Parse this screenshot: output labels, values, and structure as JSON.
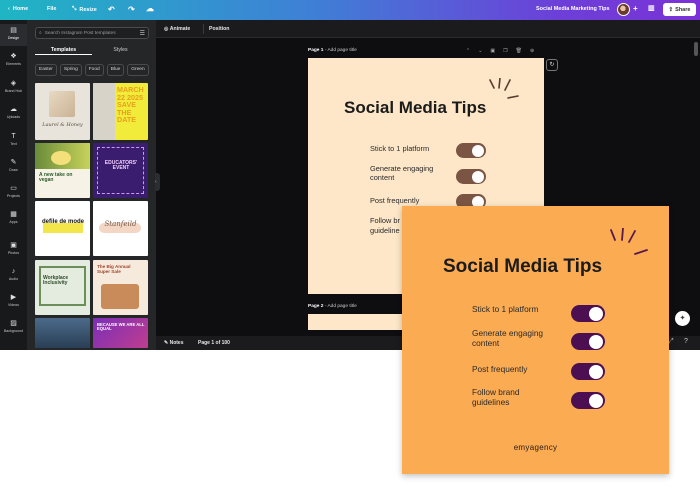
{
  "topbar": {
    "home": "Home",
    "file": "File",
    "resize": "Resize",
    "doc_title": "Social Media Marketing Tips",
    "share": "Share"
  },
  "rail": [
    {
      "label": "Design",
      "icon": "design-icon"
    },
    {
      "label": "Elements",
      "icon": "elements-icon"
    },
    {
      "label": "Brand Hub",
      "icon": "brand-hub-icon"
    },
    {
      "label": "Uploads",
      "icon": "upload-cloud-icon"
    },
    {
      "label": "Text",
      "icon": "text-icon"
    },
    {
      "label": "Draw",
      "icon": "draw-icon"
    },
    {
      "label": "Projects",
      "icon": "folder-icon"
    },
    {
      "label": "Apps",
      "icon": "apps-icon"
    },
    {
      "label": "Photos",
      "icon": "photos-icon"
    },
    {
      "label": "Audio",
      "icon": "audio-icon"
    },
    {
      "label": "Videos",
      "icon": "videos-icon"
    },
    {
      "label": "Background",
      "icon": "background-icon"
    }
  ],
  "panel": {
    "search_placeholder": "Search Instagram Post templates",
    "tabs": [
      "Templates",
      "Styles"
    ],
    "chips": [
      "Easter",
      "Spring",
      "Food",
      "Blue",
      "Green"
    ],
    "thumbnails": [
      {
        "text": "Laurel & Honey"
      },
      {
        "text": "MARCH 22 2025 SAVE THE DATE"
      },
      {
        "text": "A new take on vegan"
      },
      {
        "text": "EDUCATORS' EVENT"
      },
      {
        "text": "defile de mode"
      },
      {
        "text": "Stanfeild"
      },
      {
        "text": "Workplace Inclusivity"
      },
      {
        "text": "The Big Annual Super Sale"
      },
      {
        "text": ""
      },
      {
        "text": "BECAUSE WE ARE ALL EQUAL"
      }
    ]
  },
  "canvas": {
    "context_bar": {
      "animate": "Animate",
      "position": "Position"
    },
    "page1_label": "Page 1",
    "page1_hint": "- Add page title",
    "page2_label": "Page 2",
    "page2_hint": "- Add page title",
    "notes": "Notes",
    "page_counter": "Page 1 of 100"
  },
  "design_canvas": {
    "title": "Social Media Tips",
    "tips": [
      "Stick to 1 platform",
      "Generate engaging content",
      "Post frequently",
      "Follow brand guidelines"
    ],
    "clipped_tip_fragments": [
      "Follow br",
      "guideline"
    ],
    "background": "#fde7c8",
    "toggle_color": "#7b5544"
  },
  "overlay_design": {
    "title": "Social Media Tips",
    "tips": [
      "Stick to 1 platform",
      "Generate engaging content",
      "Post frequently",
      "Follow brand guidelines"
    ],
    "brand": "emyagency",
    "background": "#fbab52",
    "toggle_color": "#4c1052"
  },
  "colors": {
    "topbar_start": "#1fb5c4",
    "topbar_end": "#7a32d6",
    "editor_dark": "#18191b"
  }
}
